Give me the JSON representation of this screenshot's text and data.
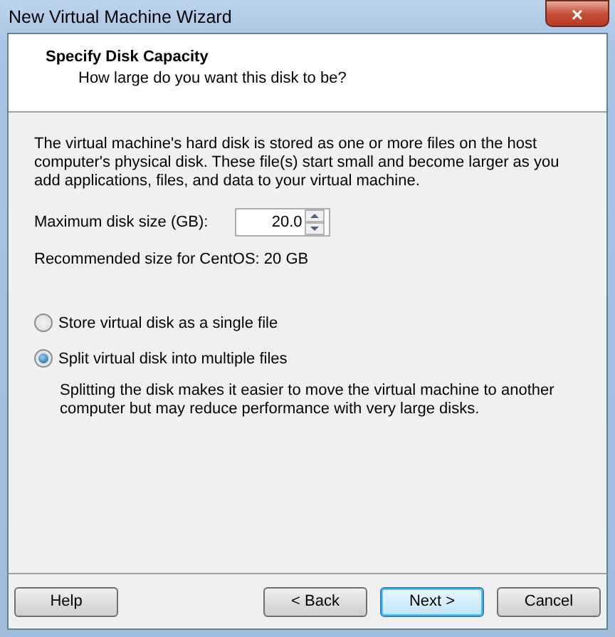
{
  "window": {
    "title": "New Virtual Machine Wizard",
    "close": "×"
  },
  "header": {
    "title": "Specify Disk Capacity",
    "subtitle": "How large do you want this disk to be?"
  },
  "intro": "The virtual machine's hard disk is stored as one or more files on the host computer's physical disk. These file(s) start small and become larger as you add applications, files, and data to your virtual machine.",
  "disk_size": {
    "label": "Maximum disk size (GB):",
    "value": "20.0"
  },
  "recommendation": "Recommended size for CentOS: 20 GB",
  "options": [
    {
      "label": "Store virtual disk as a single file",
      "selected": false
    },
    {
      "label": "Split virtual disk into multiple files",
      "selected": true,
      "description": "Splitting the disk makes it easier to move the virtual machine to another computer but may reduce performance with very large disks."
    }
  ],
  "buttons": [
    {
      "label": "Help",
      "kind": "plain"
    },
    {
      "label": "< Back",
      "kind": "plain"
    },
    {
      "label": "Next >",
      "kind": "default"
    },
    {
      "label": "Cancel",
      "kind": "plain"
    }
  ]
}
